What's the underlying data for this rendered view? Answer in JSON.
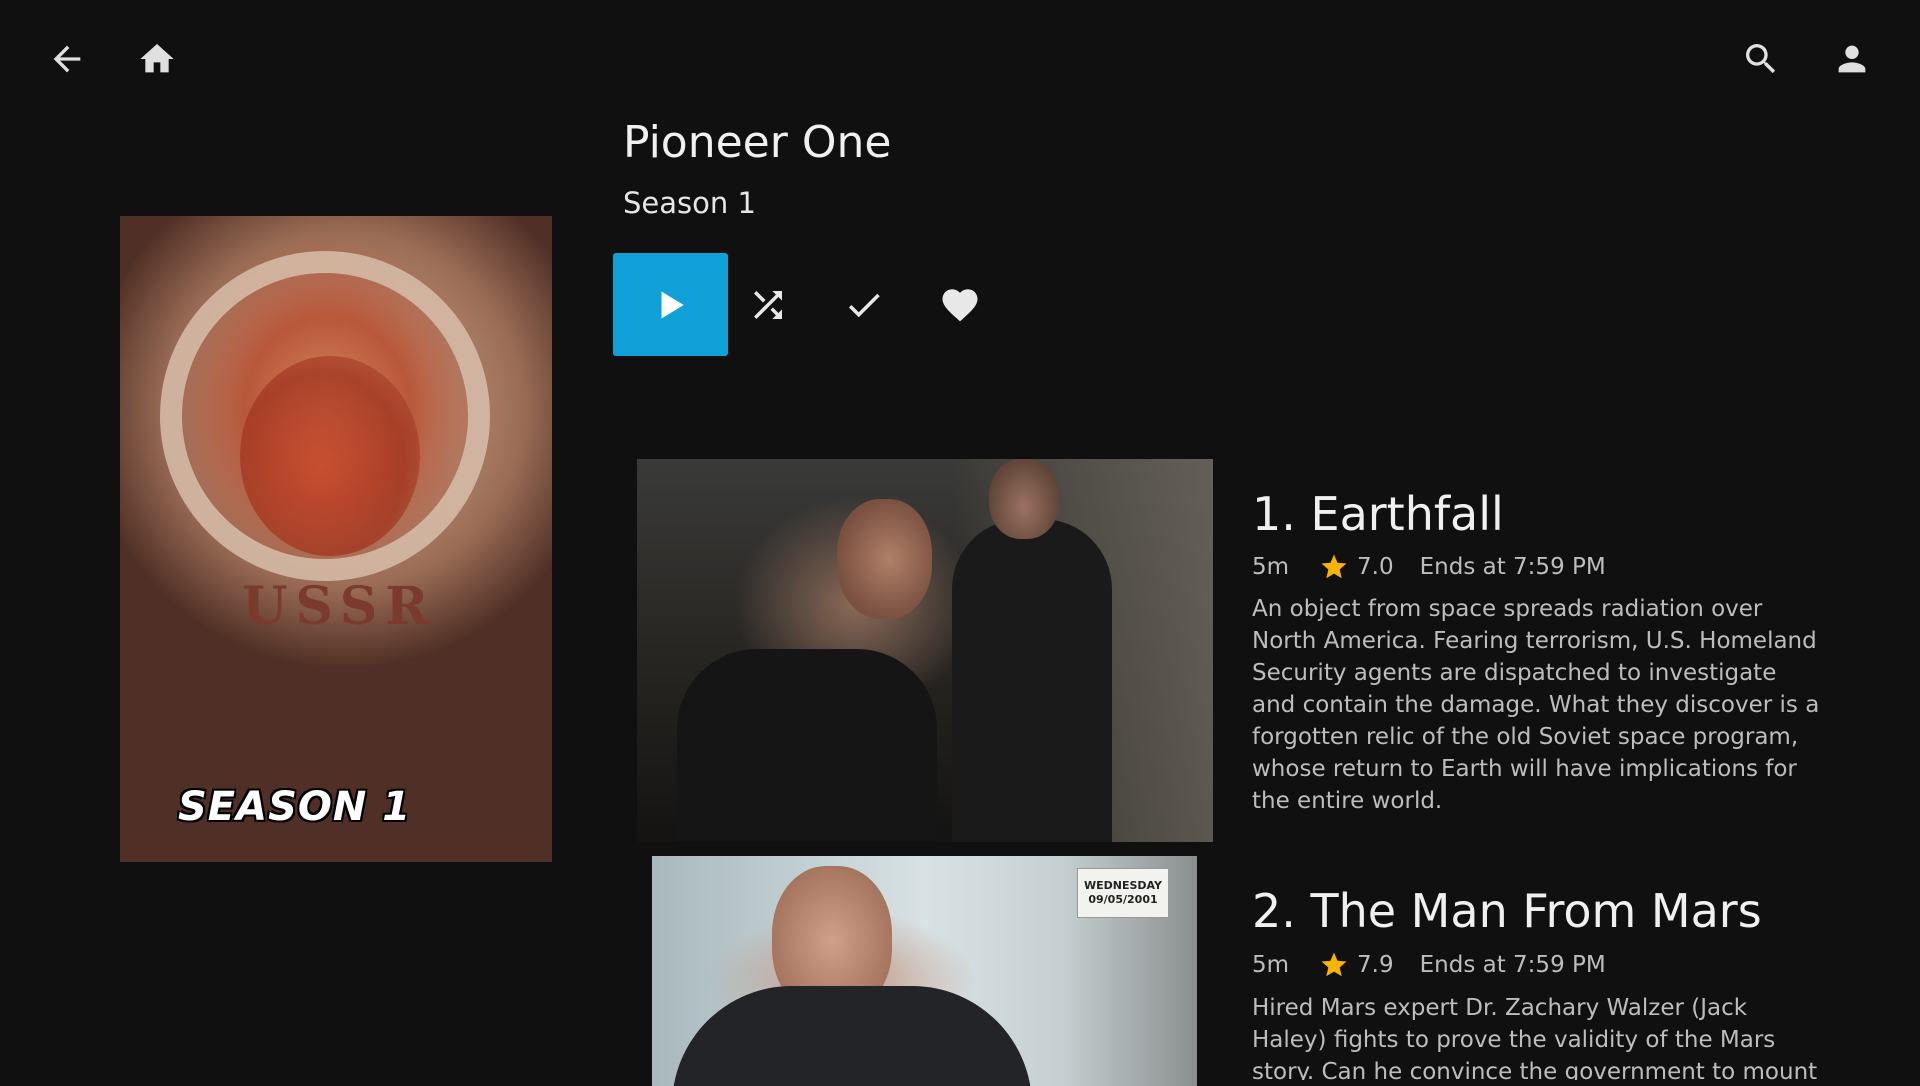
{
  "topbar": {
    "back_icon": "arrow-left-icon",
    "home_icon": "home-icon",
    "search_icon": "search-icon",
    "user_icon": "person-icon"
  },
  "header": {
    "series_title": "Pioneer One",
    "season_label": "Season 1"
  },
  "poster": {
    "badge": "SEASON 1",
    "text": "USSR"
  },
  "actions": {
    "play_icon": "play-icon",
    "shuffle_icon": "shuffle-icon",
    "watched_icon": "check-icon",
    "favorite_icon": "heart-icon",
    "play_color": "#0fa0d8"
  },
  "episodes": [
    {
      "title": "1. Earthfall",
      "runtime": "5m",
      "rating": "7.0",
      "ends_at": "Ends at 7:59 PM",
      "description": "An object from space spreads radiation over North America. Fearing terrorism, U.S. Homeland Security agents are dispatched to investigate and contain the damage. What they discover is a forgotten relic of the old Soviet space program, whose return to Earth will have implications for the entire world."
    },
    {
      "title": "2. The Man From Mars",
      "runtime": "5m",
      "rating": "7.9",
      "ends_at": "Ends at 7:59 PM",
      "description": "Hired Mars expert Dr. Zachary Walzer (Jack Haley) fights to prove the validity of the Mars story. Can he convince the government to mount",
      "thumb_card": [
        "WEDNESDAY",
        "09/05/2001"
      ]
    }
  ],
  "star_color": "#f5b400"
}
